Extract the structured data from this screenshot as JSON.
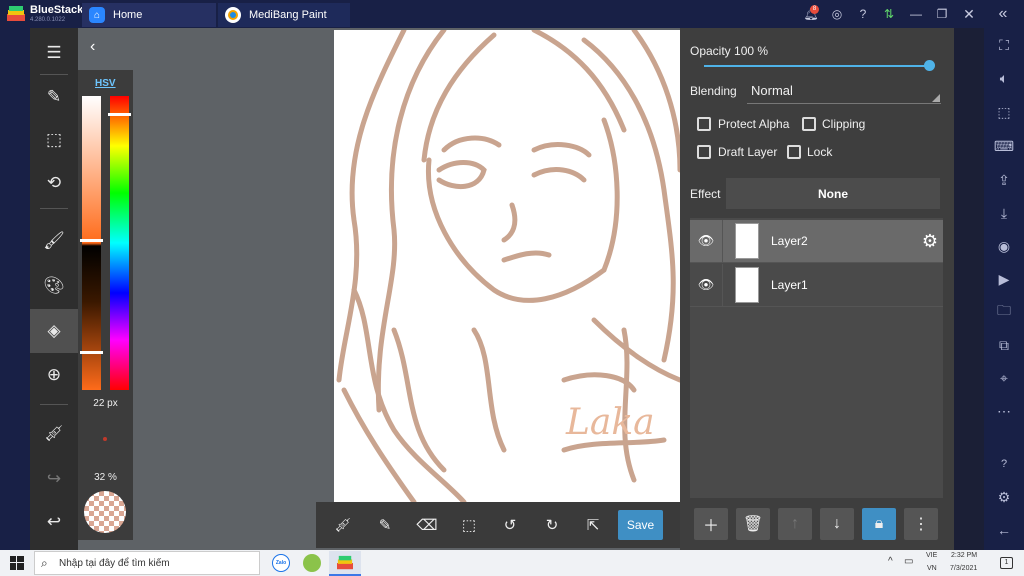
{
  "bluestacks": {
    "brand": "BlueStacks",
    "version": "4.280.0.1022"
  },
  "tabs": [
    {
      "label": "Home"
    },
    {
      "label": "MediBang Paint"
    }
  ],
  "notif_count": "8",
  "color_panel": {
    "mode": "HSV",
    "brush_size": "22 px",
    "opacity": "32 %"
  },
  "layer_panel": {
    "opacity_label": "Opacity 100 %",
    "opacity_value": 1.0,
    "blending_label": "Blending",
    "blending_value": "Normal",
    "protect_alpha": "Protect Alpha",
    "clipping": "Clipping",
    "draft_layer": "Draft Layer",
    "lock": "Lock",
    "effect_label": "Effect",
    "effect_value": "None",
    "layers": [
      {
        "name": "Layer2",
        "selected": true
      },
      {
        "name": "Layer1",
        "selected": false
      }
    ]
  },
  "toolbar": {
    "save_label": "Save"
  },
  "canvas": {
    "signature": "Laka"
  },
  "taskbar": {
    "search_placeholder": "Nhập tại đây để tìm kiếm",
    "lang_top": "VIE",
    "lang_bottom": "VN",
    "time": "2:32 PM",
    "date": "7/3/2021",
    "notif_badge": "1"
  },
  "colors": {
    "accent": "#4fb3e8",
    "save": "#3f8fc4",
    "stroke": "#c8a08c"
  }
}
